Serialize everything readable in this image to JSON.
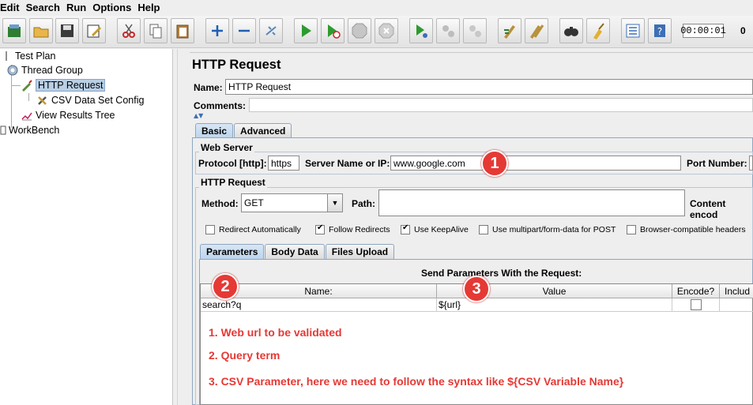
{
  "menu": {
    "items": [
      "Edit",
      "Search",
      "Run",
      "Options",
      "Help"
    ]
  },
  "toolbar": {
    "icons": [
      "template-icon",
      "open-icon",
      "save-icon",
      "edit-icon",
      "cut-icon",
      "copy-icon",
      "paste-icon",
      "expand-icon",
      "collapse-icon",
      "toggle-icon",
      "start-icon",
      "start-no-pause-icon",
      "stop-icon",
      "shutdown-icon",
      "remote-start-icon",
      "remote-stop-icon",
      "remote-shutdown-icon",
      "clear-icon",
      "clear-all-icon",
      "search-icon",
      "reset-search-icon",
      "function-helper-icon",
      "help-icon"
    ],
    "timer": "00:00:01",
    "error_count": "0"
  },
  "tree": {
    "test_plan": "Test Plan",
    "thread_group": "Thread Group",
    "http_request": "HTTP Request",
    "csv_config": "CSV Data Set Config",
    "results_tree": "View Results Tree",
    "workbench": "WorkBench"
  },
  "panel": {
    "title": "HTTP Request",
    "name_label": "Name:",
    "name_value": "HTTP Request",
    "comments_label": "Comments:",
    "tabs": [
      "Basic",
      "Advanced"
    ],
    "web_server": {
      "title": "Web Server",
      "protocol_label": "Protocol [http]:",
      "protocol_value": "https",
      "server_label": "Server Name or IP:",
      "server_value": "www.google.com",
      "port_label": "Port Number:"
    },
    "http_request": {
      "title": "HTTP Request",
      "method_label": "Method:",
      "method_value": "GET",
      "path_label": "Path:",
      "content_label": "Content encod"
    },
    "checkboxes": [
      {
        "label": "Redirect Automatically",
        "checked": false
      },
      {
        "label": "Follow Redirects",
        "checked": true
      },
      {
        "label": "Use KeepAlive",
        "checked": true
      },
      {
        "label": "Use multipart/form-data for POST",
        "checked": false
      },
      {
        "label": "Browser-compatible headers",
        "checked": false
      }
    ],
    "subtabs": [
      "Parameters",
      "Body Data",
      "Files Upload"
    ],
    "params": {
      "caption": "Send Parameters With the Request:",
      "headers": [
        "Name:",
        "Value",
        "Encode?",
        "Includ"
      ],
      "row": {
        "name": "search?q",
        "value": "${url}"
      }
    }
  },
  "annotations": {
    "badges": [
      "1",
      "2",
      "3"
    ],
    "notes": [
      "1. Web url to be validated",
      "2. Query term",
      "3. CSV Parameter, here we need to follow the syntax like ${CSV Variable Name}"
    ]
  },
  "colors": {
    "annotation": "#e53935",
    "selection": "#b8cfe5",
    "tab_active": "#bcd4ec"
  }
}
